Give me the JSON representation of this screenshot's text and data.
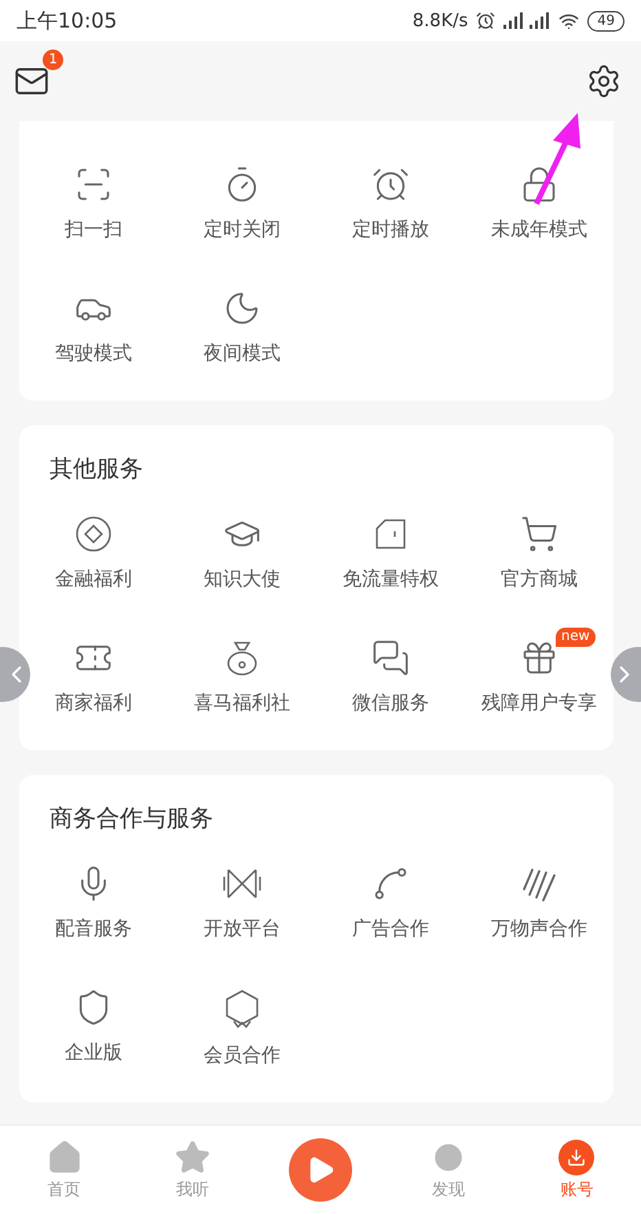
{
  "status_bar": {
    "time": "上午10:05",
    "speed": "8.8K/s",
    "battery": "49"
  },
  "header": {
    "mail_badge": "1"
  },
  "sections": [
    {
      "items": [
        {
          "label": "扫一扫"
        },
        {
          "label": "定时关闭"
        },
        {
          "label": "定时播放"
        },
        {
          "label": "未成年模式"
        },
        {
          "label": "驾驶模式"
        },
        {
          "label": "夜间模式"
        }
      ]
    },
    {
      "title": "其他服务",
      "items": [
        {
          "label": "金融福利"
        },
        {
          "label": "知识大使"
        },
        {
          "label": "免流量特权"
        },
        {
          "label": "官方商城"
        },
        {
          "label": "商家福利"
        },
        {
          "label": "喜马福利社"
        },
        {
          "label": "微信服务"
        },
        {
          "label": "残障用户专享",
          "badge": "new"
        }
      ]
    },
    {
      "title": "商务合作与服务",
      "items": [
        {
          "label": "配音服务"
        },
        {
          "label": "开放平台"
        },
        {
          "label": "广告合作"
        },
        {
          "label": "万物声合作"
        },
        {
          "label": "企业版"
        },
        {
          "label": "会员合作"
        }
      ]
    }
  ],
  "tab_bar": [
    {
      "label": "首页",
      "selected": false
    },
    {
      "label": "我听",
      "selected": false
    },
    {
      "kind": "play"
    },
    {
      "label": "发现",
      "selected": false
    },
    {
      "label": "账号",
      "selected": true
    }
  ]
}
